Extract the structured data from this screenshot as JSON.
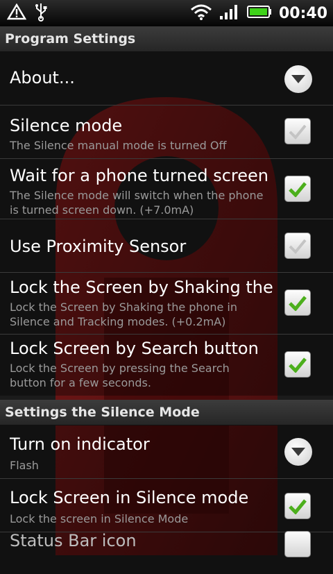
{
  "status_bar": {
    "time": "00:40",
    "icons": [
      "warning-icon",
      "usb-icon",
      "wifi-icon",
      "signal-icon",
      "battery-icon"
    ]
  },
  "sections": [
    {
      "header": "Program Settings",
      "items": [
        {
          "title": "About...",
          "summary": "",
          "control": "dropdown"
        },
        {
          "title": "Silence mode",
          "summary": "The Silence manual mode is turned Off",
          "control": "checkbox",
          "checked": false
        },
        {
          "title": "Wait for a phone turned screen d",
          "summary": "The Silence mode will switch when the phone is turned screen down. (+7.0mA)",
          "control": "checkbox",
          "checked": true
        },
        {
          "title": "Use Proximity Sensor",
          "summary": "",
          "control": "checkbox",
          "checked": false
        },
        {
          "title": "Lock the Screen by Shaking the p",
          "summary": "Lock the Screen by Shaking the phone in Silence and Tracking modes. (+0.2mA)",
          "control": "checkbox",
          "checked": true
        },
        {
          "title": "Lock Screen by Search button",
          "summary": "Lock the Screen by pressing the Search button for a few seconds.",
          "control": "checkbox",
          "checked": true
        }
      ]
    },
    {
      "header": "Settings the Silence Mode",
      "items": [
        {
          "title": "Turn on indicator",
          "summary": "Flash",
          "control": "dropdown"
        },
        {
          "title": "Lock Screen in Silence mode",
          "summary": "Lock the screen in Silence Mode",
          "control": "checkbox",
          "checked": true
        },
        {
          "title": "Status Bar icon",
          "summary": "",
          "control": "checkbox",
          "checked": false
        }
      ]
    }
  ],
  "colors": {
    "check_green": "#4caf1c",
    "check_grey": "#bdbdbd",
    "watermark_red": "#7a1010"
  }
}
